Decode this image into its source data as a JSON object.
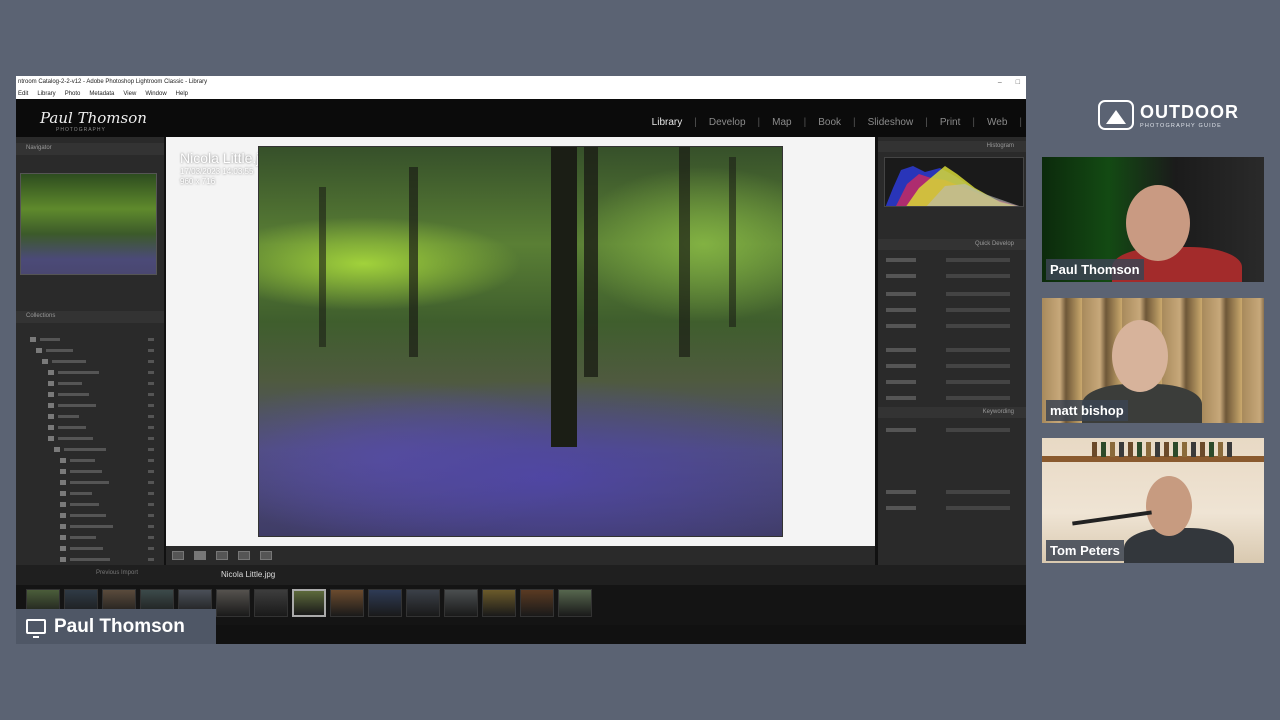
{
  "window": {
    "title": "ntroom Catalog-2-2-v12 - Adobe Photoshop Lightroom Classic - Library",
    "menu": [
      "Edit",
      "Library",
      "Photo",
      "Metadata",
      "View",
      "Window",
      "Help"
    ]
  },
  "modules": [
    {
      "label": "Library",
      "active": true
    },
    {
      "label": "Develop",
      "active": false
    },
    {
      "label": "Map",
      "active": false
    },
    {
      "label": "Book",
      "active": false
    },
    {
      "label": "Slideshow",
      "active": false
    },
    {
      "label": "Print",
      "active": false
    },
    {
      "label": "Web",
      "active": false
    }
  ],
  "left_panel": {
    "navigator_label": "Navigator",
    "collections_label": "Collections"
  },
  "right_panel": {
    "histogram_label": "Histogram",
    "quick_develop_label": "Quick Develop",
    "keywording_label": "Keywording"
  },
  "photo": {
    "filename": "Nicola Little.jpg",
    "date": "17/03/2023 14:03:55",
    "dimensions": "960 x 716"
  },
  "filmstrip": {
    "current_file": "Nicola Little.jpg"
  },
  "presenter_badge": {
    "name": "Paul Thomson"
  },
  "brand": {
    "name": "OUTDOOR",
    "tagline": "PHOTOGRAPHY GUIDE"
  },
  "participants": [
    {
      "name": "Paul Thomson"
    },
    {
      "name": "matt bishop"
    },
    {
      "name": "Tom Peters"
    }
  ],
  "colors": {
    "background": "#5b6373",
    "badge": "#4f5766"
  }
}
